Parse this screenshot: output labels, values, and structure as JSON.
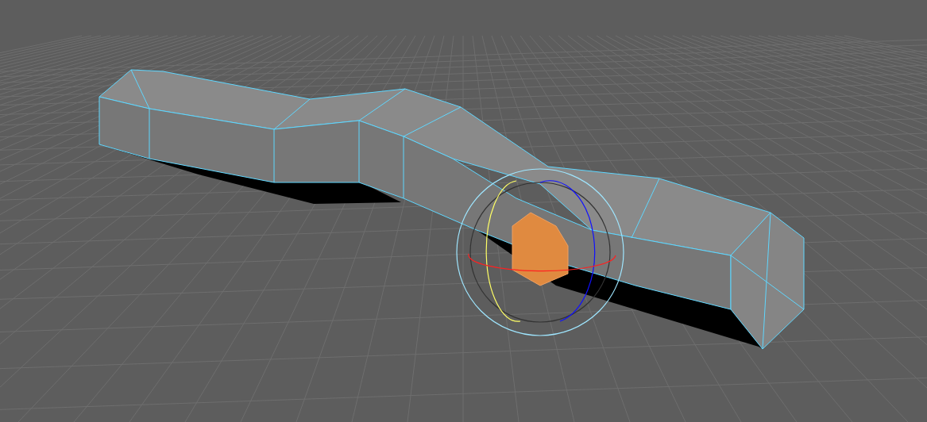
{
  "mesh": {
    "face": {
      "selected": true
    }
  }
}
